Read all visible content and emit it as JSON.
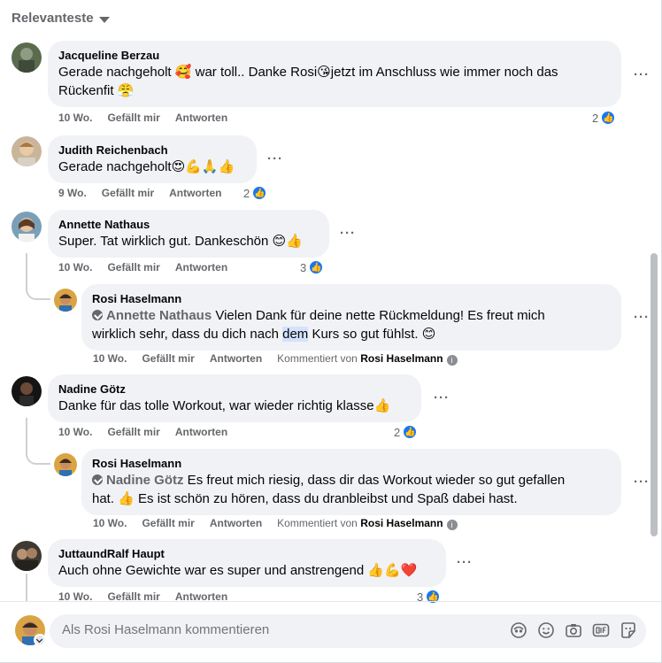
{
  "sort": {
    "label": "Relevanteste"
  },
  "comments": [
    {
      "author": "Jacqueline Berzau",
      "text_line1": "Gerade nachgeholt 🥰 war toll.. Danke Rosi😘jetzt im Anschluss wie immer noch das",
      "text_line2": "Rückenfit 😤",
      "time": "10 Wo.",
      "like": "Gefällt mir",
      "reply": "Antworten",
      "reactions": "2"
    },
    {
      "author": "Judith Reichenbach",
      "text_line1": "Gerade nachgeholt😍💪🙏👍",
      "time": "9 Wo.",
      "like": "Gefällt mir",
      "reply": "Antworten",
      "reactions": "2"
    },
    {
      "author": "Annette Nathaus",
      "text_line1": "Super. Tat wirklich gut. Dankeschön 😊👍",
      "time": "10 Wo.",
      "like": "Gefällt mir",
      "reply": "Antworten",
      "reactions": "3"
    },
    {
      "author": "Nadine Götz",
      "text_line1": "Danke für das tolle Workout, war wieder richtig klasse👍",
      "time": "10 Wo.",
      "like": "Gefällt mir",
      "reply": "Antworten",
      "reactions": "2"
    },
    {
      "author": "JuttaundRalf Haupt",
      "text_line1": "Auch ohne Gewichte war es super und anstrengend 👍💪❤️",
      "time": "10 Wo.",
      "like": "Gefällt mir",
      "reply": "Antworten",
      "reactions": "3"
    }
  ],
  "replies": [
    {
      "author": "Rosi Haselmann",
      "tag": "Annette Nathaus",
      "text_a": " Vielen Dank für deine nette Rückmeldung! Es freut mich",
      "text_b_pre": "wirklich sehr, dass du dich nach ",
      "text_b_hl": "dem",
      "text_b_post": " Kurs so gut fühlst. 😊",
      "time": "10 Wo.",
      "like": "Gefällt mir",
      "reply": "Antworten",
      "commented_by_prefix": "Kommentiert von",
      "commented_by_name": "Rosi Haselmann"
    },
    {
      "author": "Rosi Haselmann",
      "tag": "Nadine Götz",
      "text_a": " Es freut mich riesig, dass dir das Workout wieder so gut gefallen",
      "text_b_pre": "hat. 👍 Es ist schön zu hören, dass du dranbleibst und Spaß dabei hast.",
      "time": "10 Wo.",
      "like": "Gefällt mir",
      "reply": "Antworten",
      "commented_by_prefix": "Kommentiert von",
      "commented_by_name": "Rosi Haselmann"
    }
  ],
  "composer": {
    "placeholder": "Als Rosi Haselmann kommentieren"
  },
  "icons": {
    "more": "more-options-icon",
    "like": "like-reaction-icon",
    "composer": [
      "avatar-sticker-icon",
      "emoji-icon",
      "camera-icon",
      "gif-icon",
      "sticker-icon"
    ]
  },
  "colors": {
    "accent": "#1877f2",
    "bubble": "#f0f2f5",
    "muted": "#65676b"
  }
}
